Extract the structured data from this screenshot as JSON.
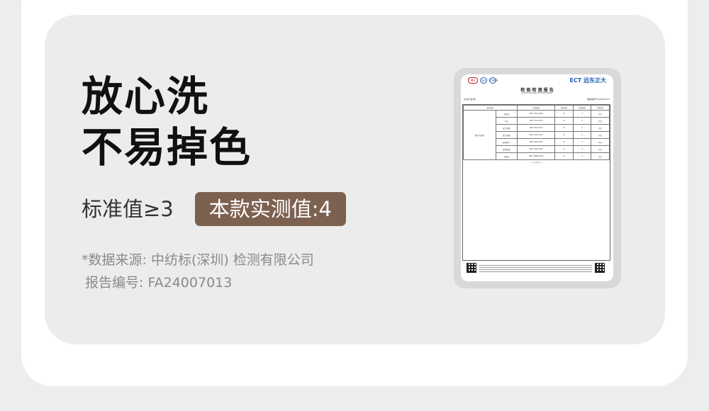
{
  "headline": {
    "line1": "放心洗",
    "line2": "不易掉色"
  },
  "standard": {
    "label": "标准值≥3",
    "measured": "本款实测值:4"
  },
  "source": {
    "line1": "*数据来源: 中纺标(深圳) 检测有限公司",
    "line2": "报告编号: FA24007013"
  },
  "document": {
    "logos": [
      "MA",
      "ilac",
      "CNAS"
    ],
    "brand": "ECT 远东正大",
    "title": "检 验 检 测 报 告",
    "subtitle": "INSPECTION AND TESTING REPORT",
    "meta_left": "共4页 第4页",
    "meta_right": "报告编号:FA24007013",
    "table_header": [
      "检验项目",
      "检验依据",
      "技术要求",
      "检测结果",
      "单项判定"
    ],
    "row_item": "颜色牢度(级)",
    "rows": [
      {
        "name": "耐皂洗",
        "method": "GB/T 3921-2008",
        "req": "≥3",
        "result": "4",
        "verdict": "符合"
      },
      {
        "name": "耐水",
        "method": "GB/T 5713-2013",
        "req": "≥3",
        "result": "4",
        "verdict": "符合"
      },
      {
        "name": "耐汗渍(酸)",
        "method": "GB/T 3922-2013",
        "req": "≥3",
        "result": "4",
        "verdict": "符合"
      },
      {
        "name": "耐汗渍(碱)",
        "method": "GB/T 3922-2013",
        "req": "≥3",
        "result": "4",
        "verdict": "符合"
      },
      {
        "name": "耐摩擦(干)",
        "method": "GB/T 3920-2008",
        "req": "≥3",
        "result": "4",
        "verdict": "符合"
      },
      {
        "name": "耐摩擦(湿)",
        "method": "GB/T 3920-2008",
        "req": "≥3",
        "result": "4",
        "verdict": "符合"
      },
      {
        "name": "耐唾液",
        "method": "GB/T 18886-2019",
        "req": "≥3",
        "result": "4",
        "verdict": "符合"
      }
    ],
    "end_note": "—— 以下空白 ——"
  }
}
